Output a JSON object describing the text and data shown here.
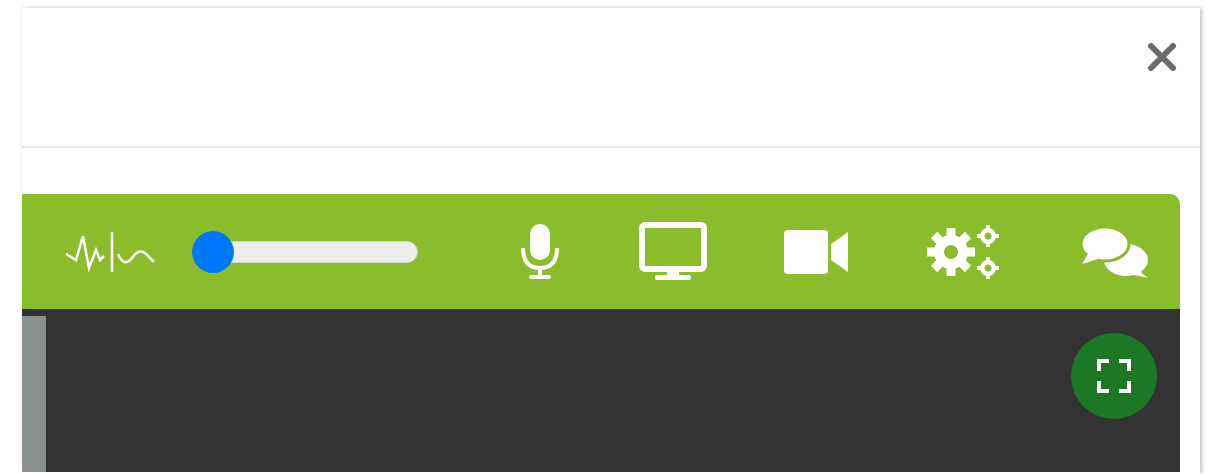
{
  "toolbar": {
    "volume": {
      "level": 0.0
    },
    "buttons": [
      {
        "kind": "microphone"
      },
      {
        "kind": "screen"
      },
      {
        "kind": "camera"
      },
      {
        "kind": "settings"
      },
      {
        "kind": "chat"
      }
    ]
  }
}
